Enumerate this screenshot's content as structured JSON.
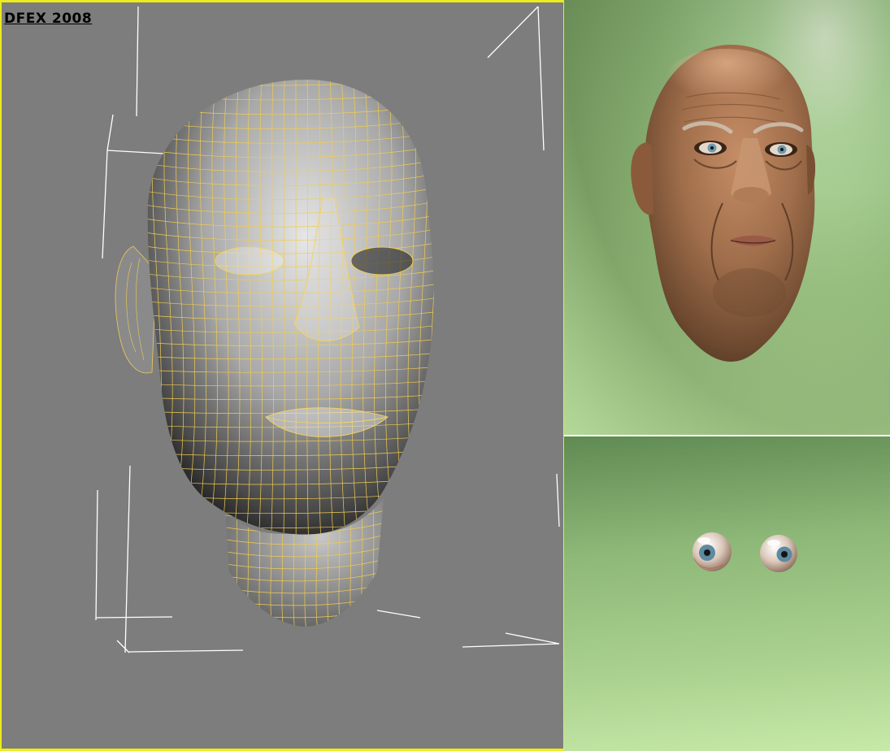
{
  "viewport": {
    "label": "DFEX 2008",
    "background": "#7d7d7d",
    "border_color": "#ecec1e",
    "wire_color": "#f0cc50",
    "bbox_color": "#ffffff",
    "content": "wireframe-head-model"
  },
  "render_face": {
    "content": "rendered-elderly-face",
    "skin_color": "#9b6a48",
    "background_color": "#9dc686"
  },
  "render_eyes": {
    "content": "rendered-eyeballs",
    "eye_count": 2,
    "background_color": "#a9d08e"
  }
}
